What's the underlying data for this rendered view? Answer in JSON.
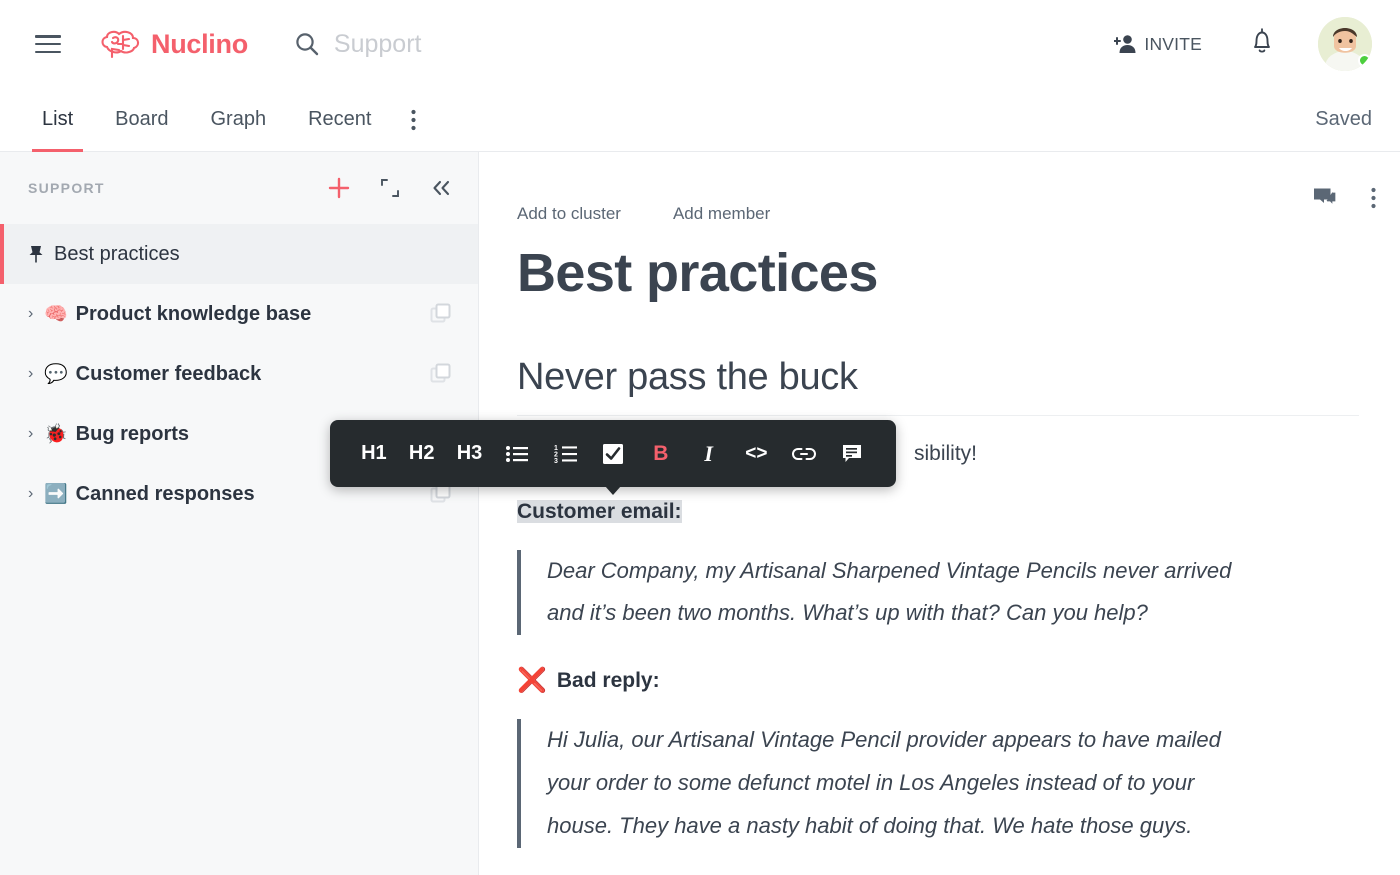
{
  "topbar": {
    "menu_icon": "hamburger-icon",
    "brand": "Nuclino",
    "search_placeholder": "Support",
    "search_icon": "search-icon",
    "invite_label": "INVITE",
    "invite_icon": "add-person-icon",
    "bell_icon": "notification-bell-icon",
    "avatar_icon": "user-avatar",
    "status": "online"
  },
  "nav": {
    "tabs": [
      {
        "label": "List",
        "active": true
      },
      {
        "label": "Board",
        "active": false
      },
      {
        "label": "Graph",
        "active": false
      },
      {
        "label": "Recent",
        "active": false
      }
    ],
    "more_icon": "overflow-menu-icon",
    "save_status": "Saved"
  },
  "sidebar": {
    "title": "SUPPORT",
    "actions": [
      {
        "name": "add-item-button",
        "icon": "plus-icon"
      },
      {
        "name": "expand-button",
        "icon": "expand-icon"
      },
      {
        "name": "collapse-sidebar-button",
        "icon": "double-chevron-left-icon"
      }
    ],
    "items": [
      {
        "label": "Best practices",
        "emoji": "",
        "pinned": true,
        "active": true,
        "caret": false,
        "duplicate": false
      },
      {
        "label": "Product knowledge base",
        "emoji": "🧠",
        "pinned": false,
        "active": false,
        "caret": true,
        "duplicate": true
      },
      {
        "label": "Customer feedback",
        "emoji": "💬",
        "pinned": false,
        "active": false,
        "caret": true,
        "duplicate": true
      },
      {
        "label": "Bug reports",
        "emoji": "🐞",
        "pinned": false,
        "active": false,
        "caret": true,
        "duplicate": false
      },
      {
        "label": "Canned responses",
        "emoji": "➡️",
        "pinned": false,
        "active": false,
        "caret": true,
        "duplicate": true
      }
    ]
  },
  "document": {
    "actions": [
      {
        "label": "Add to cluster"
      },
      {
        "label": "Add member"
      }
    ],
    "icons": [
      {
        "name": "comments-icon"
      },
      {
        "name": "document-menu-icon"
      }
    ],
    "title": "Best practices",
    "heading2": "Never pass the buck",
    "paragraph_partial": "sibility!",
    "highlighted_line": "Customer email:",
    "quote1_line1": "Dear Company, my Artisanal Sharpened Vintage Pencils never arrived",
    "quote1_line2": "and it’s been two months. What’s up with that? Can you help?",
    "bad_reply_icon": "❌",
    "bad_reply_label": "Bad reply:",
    "quote2_line1": "Hi Julia, our Artisanal Vintage Pencil provider appears to have mailed",
    "quote2_line2": "your order to some defunct motel in Los Angeles instead of to your",
    "quote2_line3": "house. They have a nasty habit of doing that. We hate those guys."
  },
  "format_toolbar": {
    "buttons": [
      {
        "label": "H1",
        "name": "heading1-button",
        "type": "text"
      },
      {
        "label": "H2",
        "name": "heading2-button",
        "type": "text"
      },
      {
        "label": "H3",
        "name": "heading3-button",
        "type": "text"
      },
      {
        "label": "",
        "name": "bullet-list-icon",
        "type": "icon"
      },
      {
        "label": "",
        "name": "numbered-list-icon",
        "type": "icon"
      },
      {
        "label": "",
        "name": "checklist-icon",
        "type": "icon"
      },
      {
        "label": "B",
        "name": "bold-button",
        "type": "text",
        "active": true
      },
      {
        "label": "I",
        "name": "italic-button",
        "type": "text"
      },
      {
        "label": "<>",
        "name": "code-button",
        "type": "text"
      },
      {
        "label": "",
        "name": "link-icon",
        "type": "icon"
      },
      {
        "label": "",
        "name": "comment-icon",
        "type": "icon"
      }
    ]
  },
  "colors": {
    "brand": "#f4606c",
    "toolbar_bg": "#262b2e",
    "text": "#3b4450",
    "sidebar_bg": "#f7f8f9",
    "online": "#4ccf3e"
  }
}
